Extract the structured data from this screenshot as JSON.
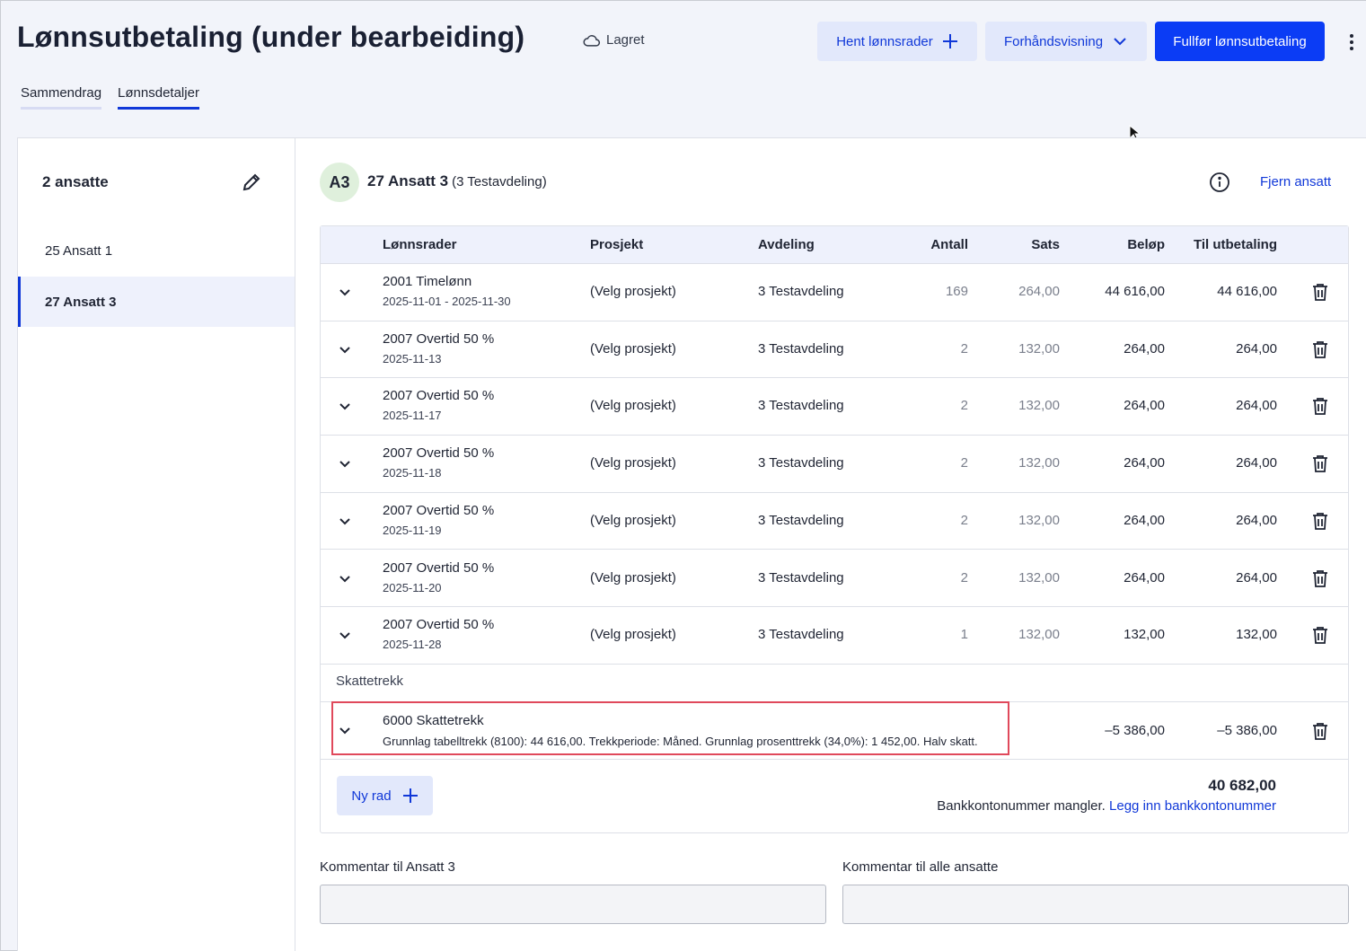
{
  "header": {
    "title": "Lønnsutbetaling (under bearbeiding)",
    "saved_label": "Lagret",
    "fetch_button": "Hent lønnsrader",
    "preview_button": "Forhåndsvisning",
    "finish_button": "Fullfør lønnsutbetaling"
  },
  "tabs": [
    {
      "label": "Sammendrag",
      "active": false
    },
    {
      "label": "Lønnsdetaljer",
      "active": true
    }
  ],
  "sidebar": {
    "title": "2 ansatte",
    "items": [
      {
        "label": "25 Ansatt 1",
        "active": false
      },
      {
        "label": "27 Ansatt 3",
        "active": true
      }
    ]
  },
  "employee": {
    "initials": "A3",
    "name": "27 Ansatt 3",
    "department": "(3 Testavdeling)",
    "remove_label": "Fjern ansatt"
  },
  "table": {
    "headers": {
      "lonnsrader": "Lønnsrader",
      "prosjekt": "Prosjekt",
      "avdeling": "Avdeling",
      "antall": "Antall",
      "sats": "Sats",
      "belop": "Beløp",
      "til_utbetaling": "Til utbetaling"
    },
    "rows": [
      {
        "title": "2001 Timelønn",
        "date": "2025-11-01 - 2025-11-30",
        "project": "(Velg prosjekt)",
        "department": "3 Testavdeling",
        "quantity": "169",
        "rate": "264,00",
        "amount": "44 616,00",
        "payout": "44 616,00"
      },
      {
        "title": "2007 Overtid 50 %",
        "date": "2025-11-13",
        "project": "(Velg prosjekt)",
        "department": "3 Testavdeling",
        "quantity": "2",
        "rate": "132,00",
        "amount": "264,00",
        "payout": "264,00"
      },
      {
        "title": "2007 Overtid 50 %",
        "date": "2025-11-17",
        "project": "(Velg prosjekt)",
        "department": "3 Testavdeling",
        "quantity": "2",
        "rate": "132,00",
        "amount": "264,00",
        "payout": "264,00"
      },
      {
        "title": "2007 Overtid 50 %",
        "date": "2025-11-18",
        "project": "(Velg prosjekt)",
        "department": "3 Testavdeling",
        "quantity": "2",
        "rate": "132,00",
        "amount": "264,00",
        "payout": "264,00"
      },
      {
        "title": "2007 Overtid 50 %",
        "date": "2025-11-19",
        "project": "(Velg prosjekt)",
        "department": "3 Testavdeling",
        "quantity": "2",
        "rate": "132,00",
        "amount": "264,00",
        "payout": "264,00"
      },
      {
        "title": "2007 Overtid 50 %",
        "date": "2025-11-20",
        "project": "(Velg prosjekt)",
        "department": "3 Testavdeling",
        "quantity": "2",
        "rate": "132,00",
        "amount": "264,00",
        "payout": "264,00"
      },
      {
        "title": "2007 Overtid 50 %",
        "date": "2025-11-28",
        "project": "(Velg prosjekt)",
        "department": "3 Testavdeling",
        "quantity": "1",
        "rate": "132,00",
        "amount": "132,00",
        "payout": "132,00"
      }
    ],
    "tax_section_label": "Skattetrekk",
    "tax_row": {
      "title": "6000 Skattetrekk",
      "detail": "Grunnlag tabelltrekk (8100): 44 616,00. Trekkperiode: Måned. Grunnlag prosenttrekk (34,0%): 1 452,00. Halv skatt.",
      "amount": "–5 386,00",
      "payout": "–5 386,00"
    },
    "new_row_button": "Ny rad",
    "total": "40 682,00",
    "bank_missing": "Bankkontonummer mangler.",
    "bank_link": "Legg inn bankkontonummer"
  },
  "comments": {
    "employee_label": "Kommentar til Ansatt 3",
    "employee_value": "",
    "all_label": "Kommentar til alle ansatte",
    "all_value": ""
  },
  "colors": {
    "accent": "#0b3cf5",
    "highlight_border": "#e0495b",
    "avatar_bg": "#dff0dc"
  }
}
